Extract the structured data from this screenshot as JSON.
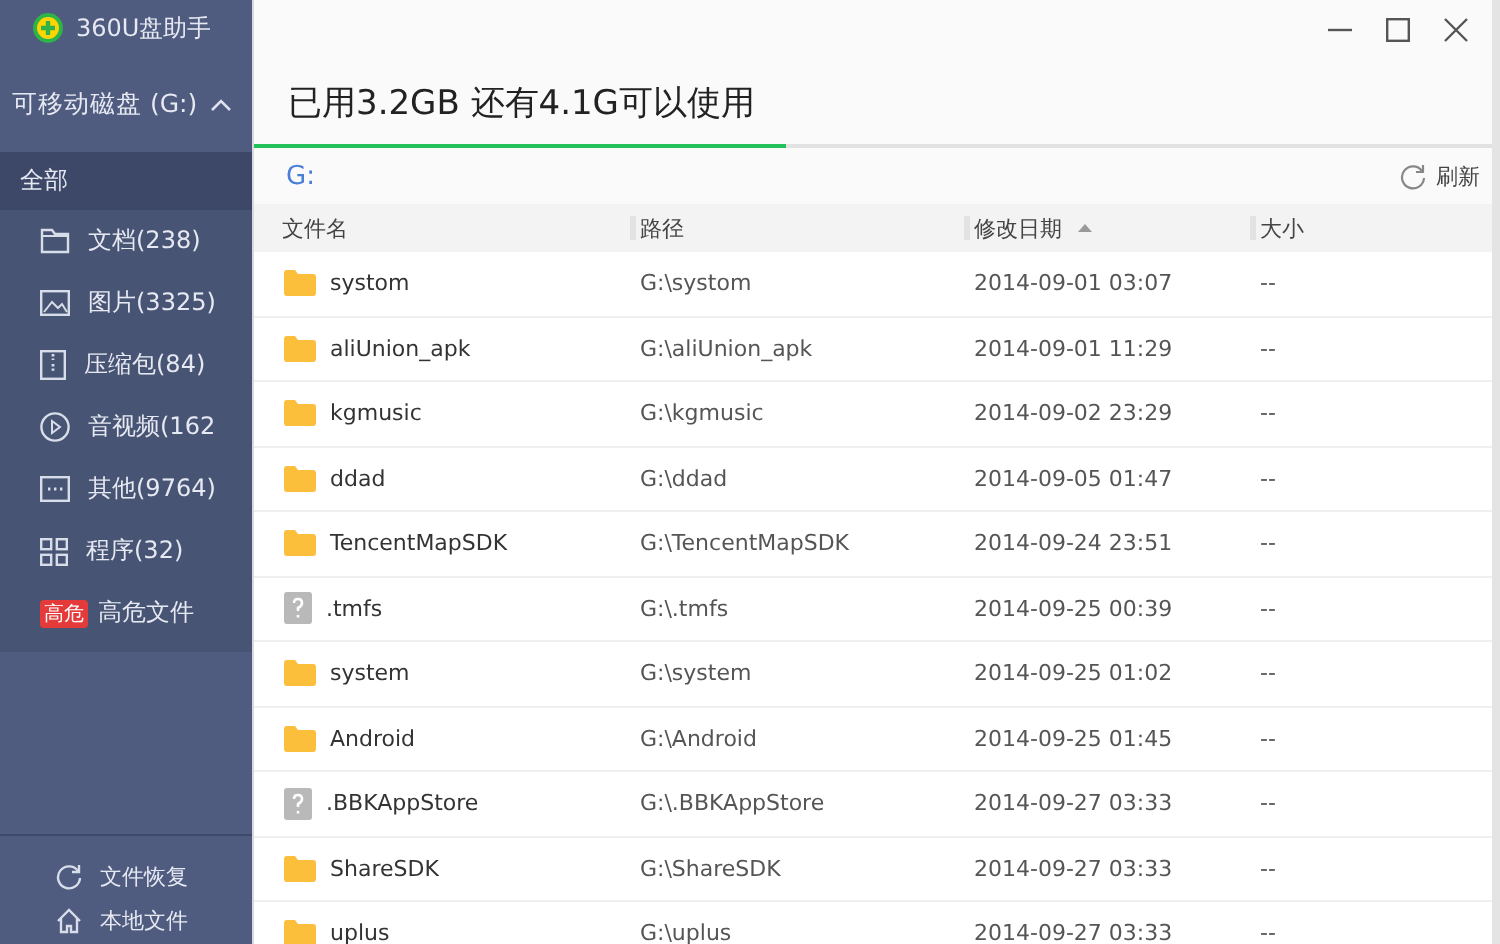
{
  "app": {
    "title": "360U盘助手"
  },
  "drive": {
    "label": "可移动磁盘 (G:)",
    "expanded": true
  },
  "sidebar": {
    "items": [
      {
        "kind": "all",
        "label": "全部",
        "selected": true
      },
      {
        "kind": "document",
        "label": "文档(238)",
        "selected": false
      },
      {
        "kind": "image",
        "label": "图片(3325)",
        "selected": false
      },
      {
        "kind": "archive",
        "label": "压缩包(84)",
        "selected": false
      },
      {
        "kind": "video",
        "label": "音视频(162",
        "selected": false
      },
      {
        "kind": "other",
        "label": "其他(9764)",
        "selected": false
      },
      {
        "kind": "apps",
        "label": "程序(32)",
        "selected": false
      },
      {
        "kind": "danger",
        "badge": "高危",
        "label": "高危文件",
        "selected": false
      }
    ],
    "footer": [
      {
        "kind": "restore",
        "label": "文件恢复"
      },
      {
        "kind": "local",
        "label": "本地文件"
      }
    ]
  },
  "usage": {
    "text": "已用3.2GB 还有4.1G可以使用",
    "level": 0.43
  },
  "path": {
    "text": "G:",
    "refresh": "刷新"
  },
  "table": {
    "columns": [
      {
        "label": "文件名",
        "sorted": false
      },
      {
        "label": "路径",
        "sorted": false
      },
      {
        "label": "修改日期",
        "sorted": true
      },
      {
        "label": "大小",
        "sorted": false
      }
    ],
    "rows": [
      {
        "kind": "folder",
        "name": "systom",
        "path": "G:\\systom",
        "date": "2014-09-01 03:07",
        "size": "--"
      },
      {
        "kind": "folder",
        "name": "aliUnion_apk",
        "path": "G:\\aliUnion_apk",
        "date": "2014-09-01 11:29",
        "size": "--"
      },
      {
        "kind": "folder",
        "name": "kgmusic",
        "path": "G:\\kgmusic",
        "date": "2014-09-02 23:29",
        "size": "--"
      },
      {
        "kind": "folder",
        "name": "ddad",
        "path": "G:\\ddad",
        "date": "2014-09-05 01:47",
        "size": "--"
      },
      {
        "kind": "folder",
        "name": "TencentMapSDK",
        "path": "G:\\TencentMapSDK",
        "date": "2014-09-24 23:51",
        "size": "--"
      },
      {
        "kind": "unknown",
        "name": ".tmfs",
        "path": "G:\\.tmfs",
        "date": "2014-09-25 00:39",
        "size": "--"
      },
      {
        "kind": "folder",
        "name": "system",
        "path": "G:\\system",
        "date": "2014-09-25 01:02",
        "size": "--"
      },
      {
        "kind": "folder",
        "name": "Android",
        "path": "G:\\Android",
        "date": "2014-09-25 01:45",
        "size": "--"
      },
      {
        "kind": "unknown",
        "name": ".BBKAppStore",
        "path": "G:\\.BBKAppStore",
        "date": "2014-09-27 03:33",
        "size": "--"
      },
      {
        "kind": "folder",
        "name": "ShareSDK",
        "path": "G:\\ShareSDK",
        "date": "2014-09-27 03:33",
        "size": "--"
      },
      {
        "kind": "folder",
        "name": "uplus",
        "path": "G:\\uplus",
        "date": "2014-09-27 03:33",
        "size": "--"
      }
    ]
  }
}
